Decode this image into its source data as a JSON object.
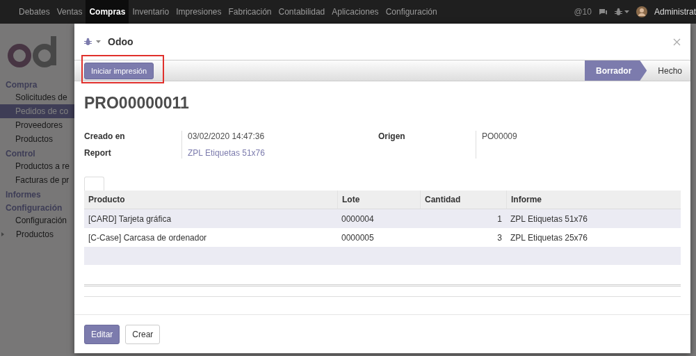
{
  "navbar": {
    "menus": [
      {
        "label": "Debates",
        "selected": false
      },
      {
        "label": "Ventas",
        "selected": false
      },
      {
        "label": "Compras",
        "selected": true
      },
      {
        "label": "Inventario",
        "selected": false
      },
      {
        "label": "Impresiones",
        "selected": false
      },
      {
        "label": "Fabricación",
        "selected": false
      },
      {
        "label": "Contabilidad",
        "selected": false
      },
      {
        "label": "Aplicaciones",
        "selected": false
      },
      {
        "label": "Configuración",
        "selected": false
      }
    ],
    "mentions": "@10",
    "user": "Administrat"
  },
  "sidebar": {
    "sections": [
      {
        "title": "Compra",
        "items": [
          {
            "label": "Solicitudes de",
            "selected": false
          },
          {
            "label": "Pedidos de co",
            "selected": true
          },
          {
            "label": "Proveedores",
            "selected": false
          },
          {
            "label": "Productos",
            "selected": false
          }
        ]
      },
      {
        "title": "Control",
        "items": [
          {
            "label": "Productos a re",
            "selected": false
          },
          {
            "label": "Facturas de pr",
            "selected": false
          }
        ]
      },
      {
        "title": "Informes"
      },
      {
        "title": "Configuración",
        "items": [
          {
            "label": "Configuración",
            "selected": false
          },
          {
            "label": "Productos",
            "selected": false,
            "collapsed": true
          }
        ]
      }
    ]
  },
  "dialog": {
    "title": "Odoo",
    "action_button": "Iniciar impresión",
    "action_highlighted": true,
    "statuses": [
      {
        "label": "Borrador",
        "selected": true
      },
      {
        "label": "Hecho",
        "selected": false
      }
    ],
    "record_name": "PRO00000011",
    "fields_left": [
      {
        "label": "Creado en",
        "value": "03/02/2020 14:47:36",
        "kind": "text"
      },
      {
        "label": "Report",
        "value": "ZPL Etiquetas 51x76",
        "kind": "link"
      }
    ],
    "fields_right": [
      {
        "label": "Origen",
        "value": "PO00009",
        "kind": "text"
      }
    ],
    "table": {
      "columns": [
        "Producto",
        "Lote",
        "Cantidad",
        "Informe"
      ],
      "rows": [
        [
          "[CARD] Tarjeta gráfica",
          "0000004",
          "1",
          "ZPL Etiquetas 51x76"
        ],
        [
          "[C-Case] Carcasa de ordenador",
          "0000005",
          "3",
          "ZPL Etiquetas 25x76"
        ]
      ]
    },
    "footer_buttons": [
      {
        "label": "Editar",
        "kind": "primary"
      },
      {
        "label": "Crear",
        "kind": "secondary"
      }
    ]
  }
}
